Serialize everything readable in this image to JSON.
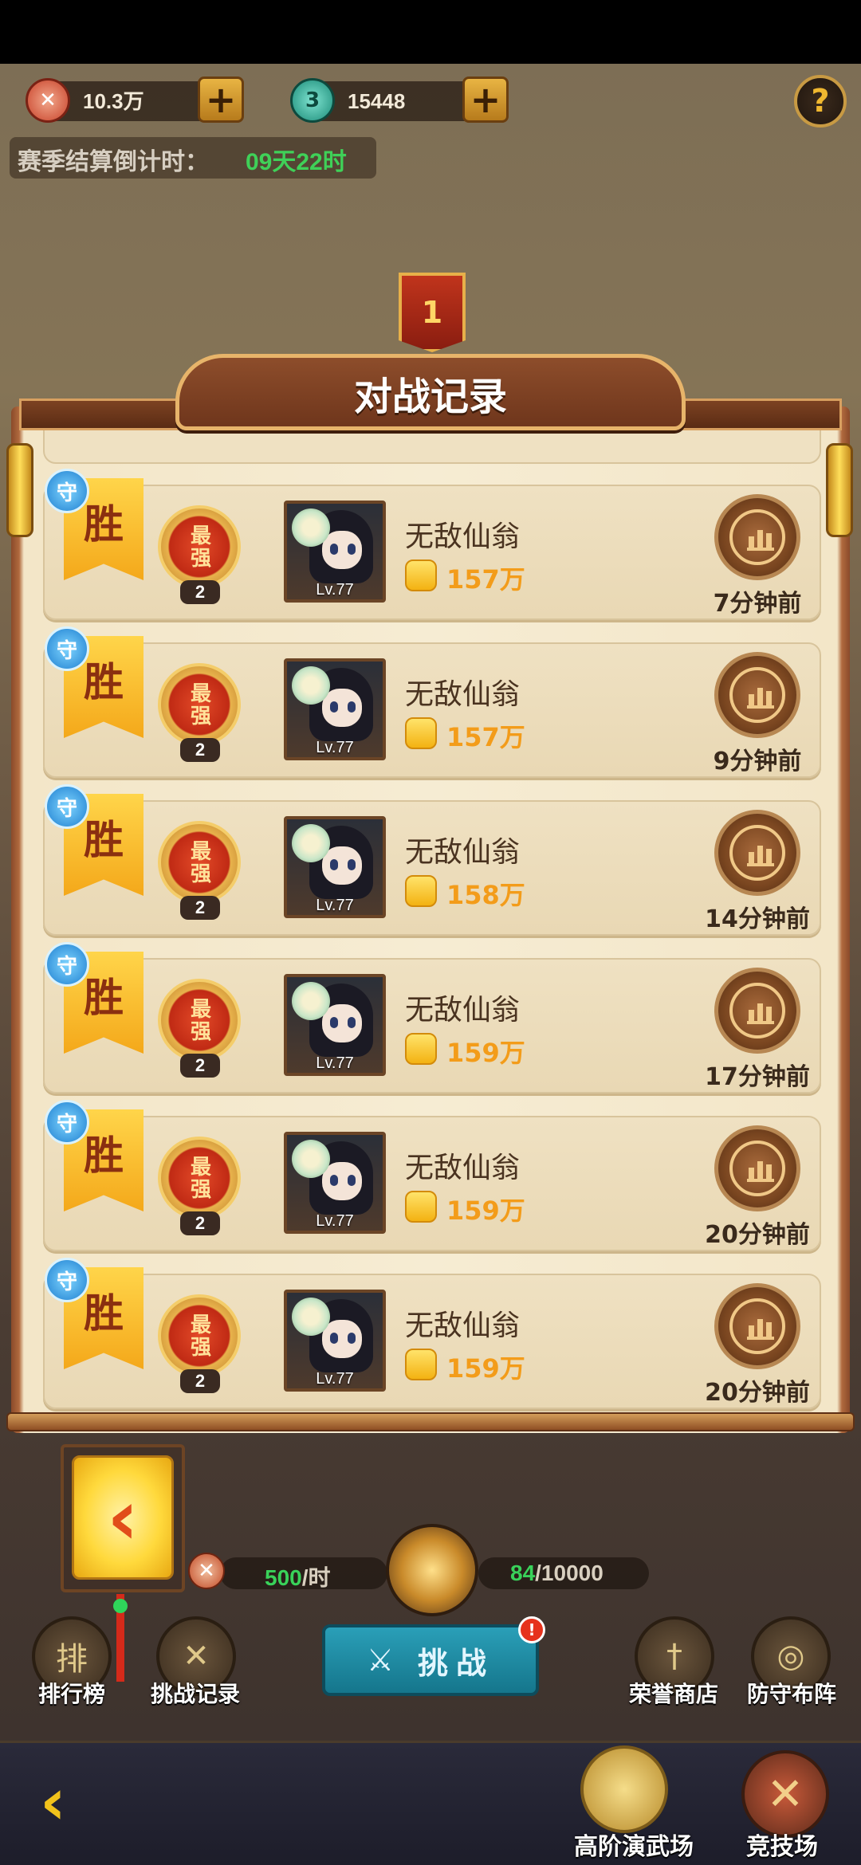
{
  "hud": {
    "honor_value": "10.3万",
    "coin_value": "15448",
    "coin_icon_text": "3",
    "plus_label": "+",
    "help_label": "?",
    "countdown_label": "赛季结算倒计时：",
    "countdown_value": "09天22时",
    "rank_banner_value": "1"
  },
  "panel": {
    "title": "对战记录"
  },
  "records": [
    {
      "result": "胜",
      "role": "守",
      "rank_title": "最强",
      "rank_level": "2",
      "level": "Lv.77",
      "name": "无敌仙翁",
      "power": "157万",
      "time": "7分钟前"
    },
    {
      "result": "胜",
      "role": "守",
      "rank_title": "最强",
      "rank_level": "2",
      "level": "Lv.77",
      "name": "无敌仙翁",
      "power": "157万",
      "time": "9分钟前"
    },
    {
      "result": "胜",
      "role": "守",
      "rank_title": "最强",
      "rank_level": "2",
      "level": "Lv.77",
      "name": "无敌仙翁",
      "power": "158万",
      "time": "14分钟前"
    },
    {
      "result": "胜",
      "role": "守",
      "rank_title": "最强",
      "rank_level": "2",
      "level": "Lv.77",
      "name": "无敌仙翁",
      "power": "159万",
      "time": "17分钟前"
    },
    {
      "result": "胜",
      "role": "守",
      "rank_title": "最强",
      "rank_level": "2",
      "level": "Lv.77",
      "name": "无敌仙翁",
      "power": "159万",
      "time": "20分钟前"
    },
    {
      "result": "胜",
      "role": "守",
      "rank_title": "最强",
      "rank_level": "2",
      "level": "Lv.77",
      "name": "无敌仙翁",
      "power": "159万",
      "time": "20分钟前"
    }
  ],
  "bottom": {
    "back_arrow": "‹",
    "rate_value": "500",
    "rate_unit": "/时",
    "store_value": "84",
    "store_max": "/10000",
    "leaderboard_label": "排行榜",
    "leaderboard_icon_text": "排",
    "challenge_log_label": "挑战记录",
    "challenge_button": "挑战",
    "alert_mark": "!",
    "honor_shop_label": "荣誉商店",
    "defense_label": "防守布阵"
  },
  "nav": {
    "advanced_arena_label": "高阶演武场",
    "arena_label": "竞技场"
  },
  "colors": {
    "accent_gold": "#f1c21b",
    "win_green": "#3fd158",
    "power_orange": "#f39c1a",
    "challenge_teal": "#2a9fb8"
  }
}
